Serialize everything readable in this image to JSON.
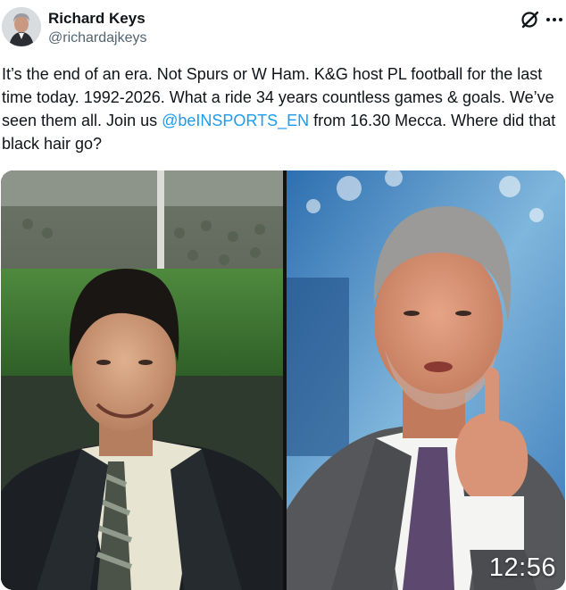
{
  "author": {
    "name": "Richard Keys",
    "handle": "@richardajkeys"
  },
  "header_icons": [
    "grok-icon",
    "more-options-icon"
  ],
  "tweet": {
    "text_before_mention": "It’s the end of an era. Not Spurs or W Ham. K&G host PL football for the last time today. 1992-2026. What a ride 34 years countless games & goals. We’ve seen them all. Join us ",
    "mention": "@beINSPORTS_EN",
    "text_after_mention": " from 16.30 Mecca. Where did that black hair go?"
  },
  "media": {
    "timestamp": "12:56"
  },
  "colors": {
    "link": "#1d9bf0",
    "text": "#0f1419",
    "secondary": "#536471"
  }
}
